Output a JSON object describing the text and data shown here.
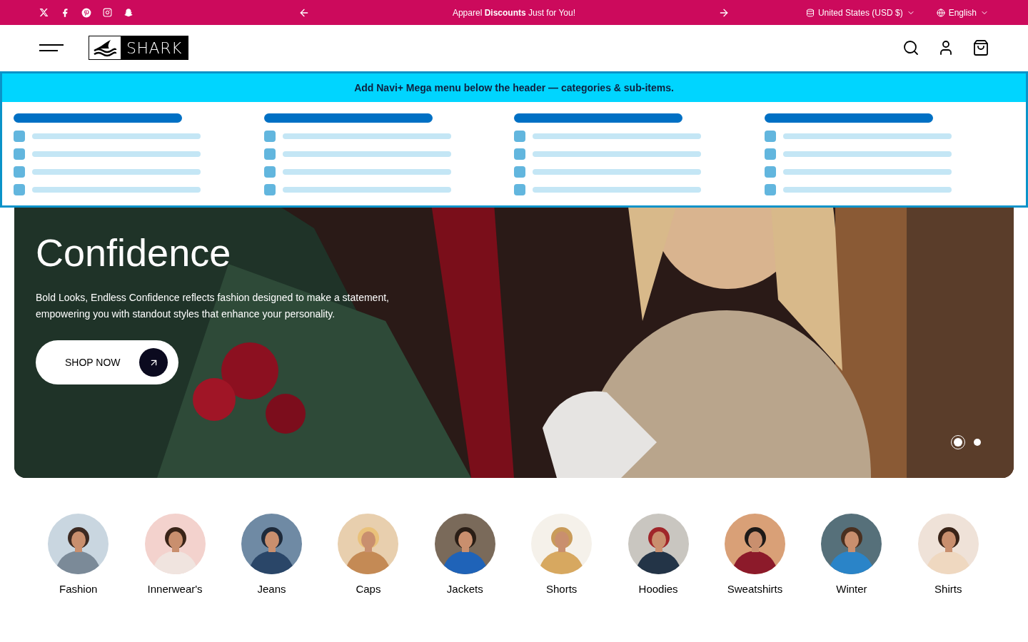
{
  "top_bar": {
    "announcement": "Apparel **Discounts** Just for You!",
    "currency": "United States (USD $)",
    "language": "English"
  },
  "header": {
    "logo": "SHARK"
  },
  "mega_menu_notice": "Add Navi+ Mega menu below the header — categories & sub-items.",
  "hero": {
    "heading": [
      "Confidence"
    ],
    "text": "Bold Looks, Endless Confidence reflects fashion designed to make a statement, empowering you with standout styles that enhance your personality.",
    "button": "SHOP NOW",
    "slides": [
      {
        "selected": true
      },
      {
        "selected": false
      }
    ]
  },
  "categories": [
    {
      "label": "Fashion"
    },
    {
      "label": "Innerwear's"
    },
    {
      "label": "Jeans"
    },
    {
      "label": "Caps"
    },
    {
      "label": "Jackets"
    },
    {
      "label": "Shorts"
    },
    {
      "label": "Hoodies"
    },
    {
      "label": "Sweatshirts"
    },
    {
      "label": "Winter"
    },
    {
      "label": "Shirts"
    }
  ]
}
